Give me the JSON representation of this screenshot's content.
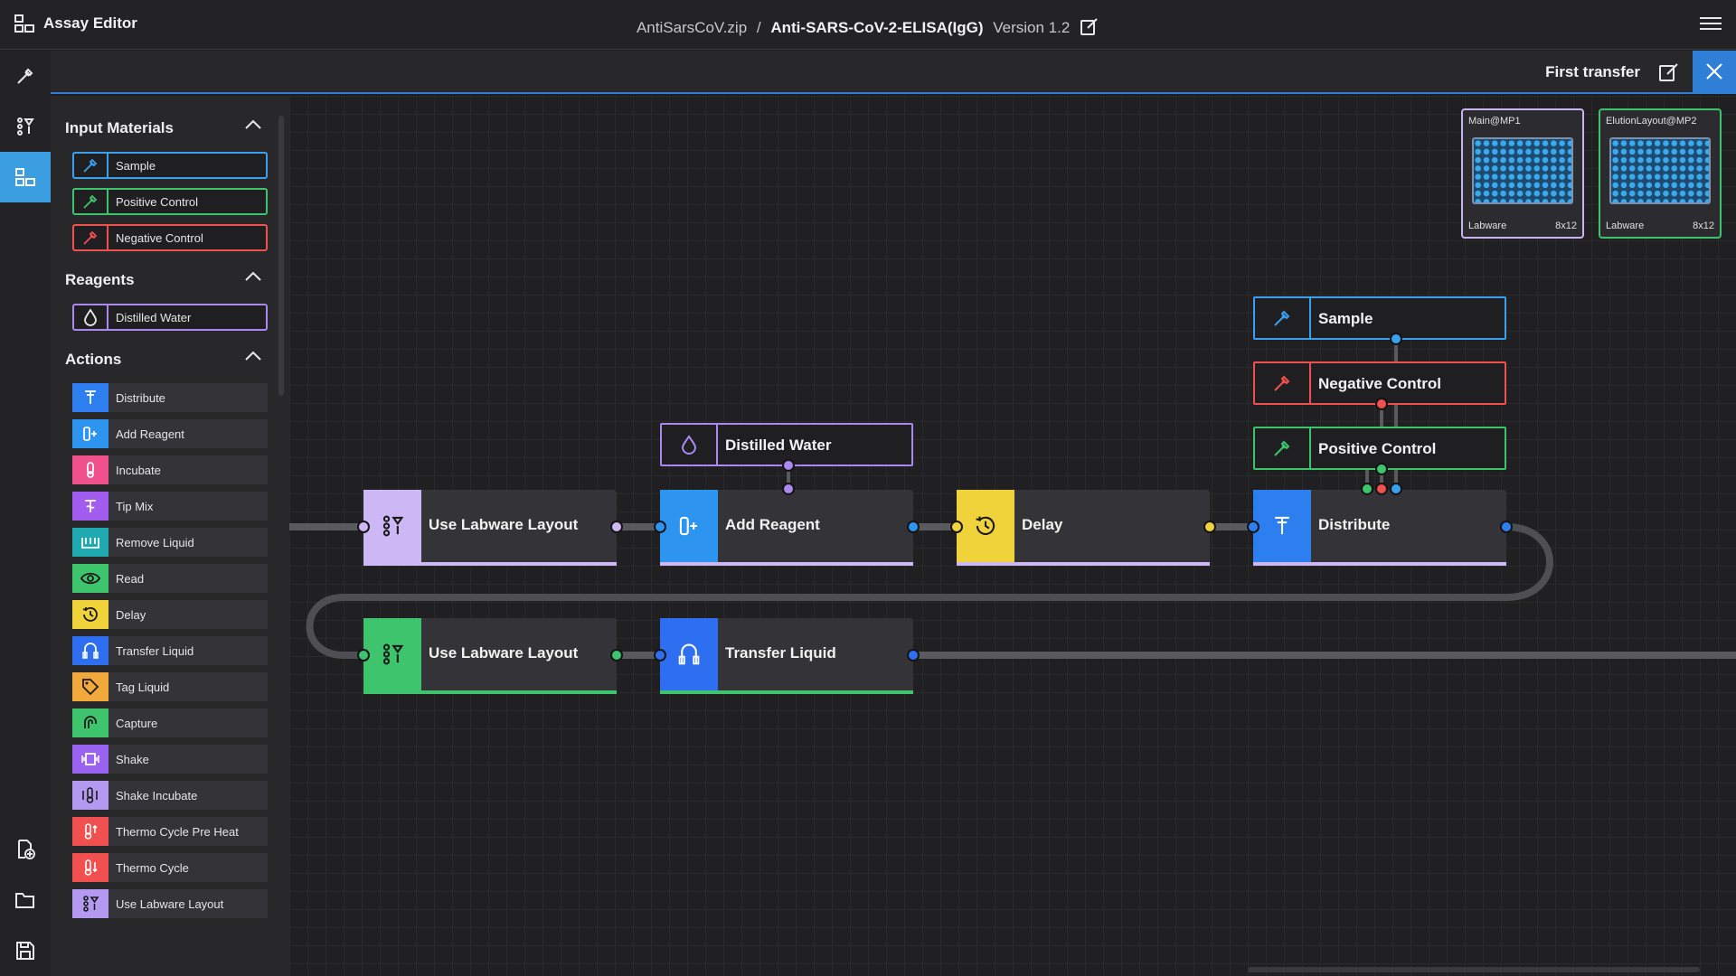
{
  "topbar": {
    "app_title": "Assay Editor",
    "file": "AntiSarsCoV.zip",
    "separator": "/",
    "assay_name": "Anti-SARS-CoV-2-ELISA(IgG)",
    "version": "Version 1.2"
  },
  "subheader": {
    "label": "First transfer"
  },
  "panel": {
    "input_materials_title": "Input Materials",
    "input_materials": [
      {
        "label": "Sample",
        "color": "#3aa0f0"
      },
      {
        "label": "Positive Control",
        "color": "#3fc46e"
      },
      {
        "label": "Negative Control",
        "color": "#f0504f"
      }
    ],
    "reagents_title": "Reagents",
    "reagents": [
      {
        "label": "Distilled Water",
        "color": "#a989f0"
      }
    ],
    "actions_title": "Actions",
    "actions": [
      {
        "label": "Distribute",
        "color": "#2d7ff0"
      },
      {
        "label": "Add Reagent",
        "color": "#2d94f0"
      },
      {
        "label": "Incubate",
        "color": "#f0508c"
      },
      {
        "label": "Tip Mix",
        "color": "#a35cf0"
      },
      {
        "label": "Remove Liquid",
        "color": "#1fa9b0"
      },
      {
        "label": "Read",
        "color": "#3fc46e"
      },
      {
        "label": "Delay",
        "color": "#f0d23a"
      },
      {
        "label": "Transfer Liquid",
        "color": "#2d6ff0"
      },
      {
        "label": "Tag Liquid",
        "color": "#f0a93a"
      },
      {
        "label": "Capture",
        "color": "#3fc46e"
      },
      {
        "label": "Shake",
        "color": "#9a62f0"
      },
      {
        "label": "Shake Incubate",
        "color": "#b39af0"
      },
      {
        "label": "Thermo Cycle Pre Heat",
        "color": "#f0504f"
      },
      {
        "label": "Thermo Cycle",
        "color": "#f0504f"
      },
      {
        "label": "Use Labware Layout",
        "color": "#b39af0"
      }
    ]
  },
  "canvas": {
    "labware": [
      {
        "name": "Main@MP1",
        "type": "Labware",
        "size": "8x12",
        "border": "#c9b5f3"
      },
      {
        "name": "ElutionLayout@MP2",
        "type": "Labware",
        "size": "8x12",
        "border": "#3fc46e"
      }
    ],
    "input_nodes": [
      {
        "label": "Sample",
        "color": "#3aa0f0"
      },
      {
        "label": "Negative Control",
        "color": "#f0504f"
      },
      {
        "label": "Positive Control",
        "color": "#3fc46e"
      },
      {
        "label": "Distilled Water",
        "color": "#a989f0"
      }
    ],
    "nodes": [
      {
        "label": "Use Labware Layout",
        "color": "#cdb8f5"
      },
      {
        "label": "Add Reagent",
        "color": "#2d94f0"
      },
      {
        "label": "Delay",
        "color": "#f0d23a"
      },
      {
        "label": "Distribute",
        "color": "#2d7ff0"
      },
      {
        "label": "Use Labware Layout",
        "color": "#3fc46e"
      },
      {
        "label": "Transfer Liquid",
        "color": "#2d6ff0"
      }
    ]
  }
}
